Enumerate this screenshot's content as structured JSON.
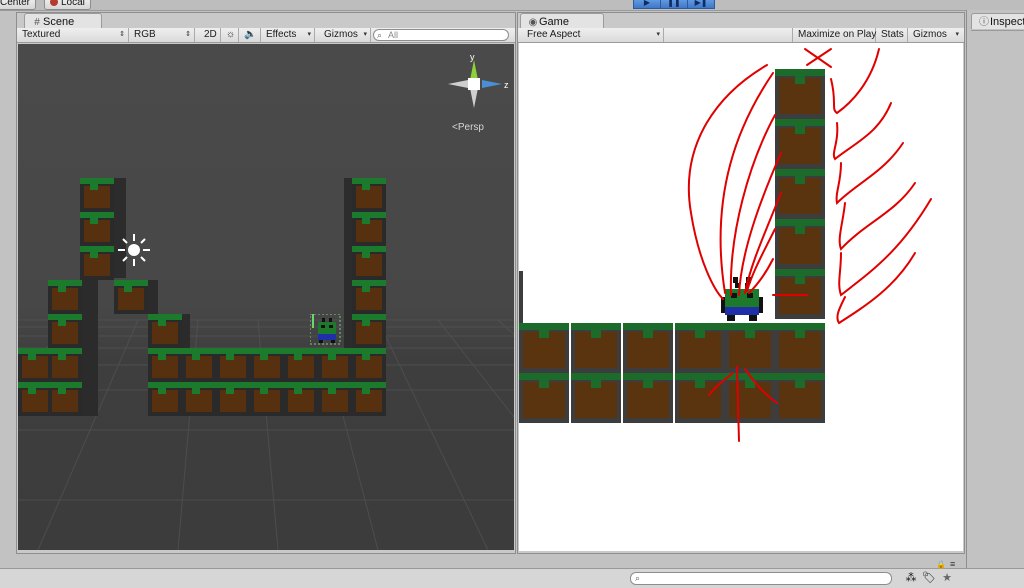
{
  "top": {
    "center_label": "Center",
    "local_label": "Local"
  },
  "scene": {
    "tab_label": "Scene",
    "toolbar": {
      "render_mode": "Textured",
      "color_mode": "RGB",
      "toggle_2d": "2D",
      "effects": "Effects",
      "gizmos": "Gizmos",
      "search_placeholder": "All"
    },
    "persp_label": "Persp",
    "gizmo_axes": {
      "y": "y",
      "z": "z"
    }
  },
  "game": {
    "tab_label": "Game",
    "toolbar": {
      "aspect": "Free Aspect",
      "maximize": "Maximize on Play",
      "stats": "Stats",
      "gizmos": "Gizmos"
    }
  },
  "inspector": {
    "tab_label": "Inspect"
  },
  "colors": {
    "play_blue": "#3f78c8",
    "scene_bg": "#474747",
    "grass": "#1c7a2d",
    "dirt": "#57310f",
    "annotation_red": "#e00000"
  }
}
